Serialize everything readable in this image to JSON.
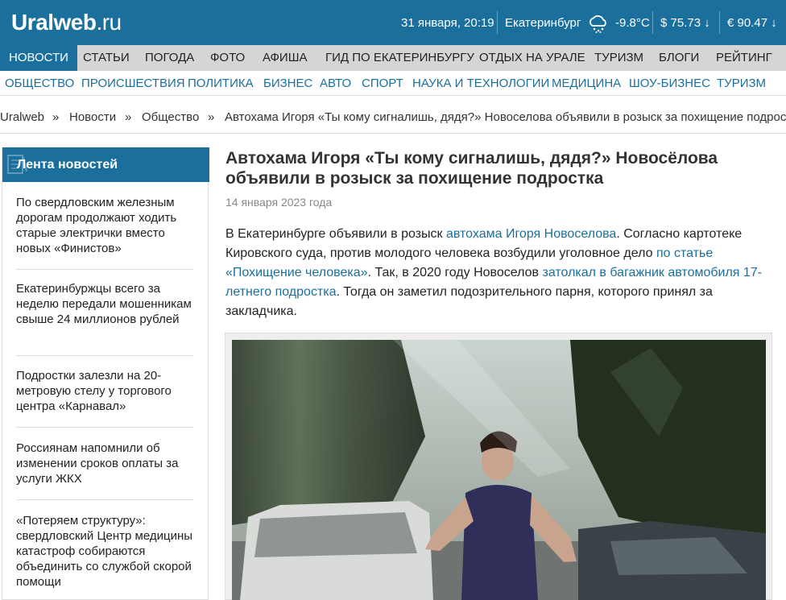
{
  "header": {
    "logo_main": "Uralweb",
    "logo_tld": ".ru",
    "datetime": "31 января, 20:19",
    "city": "Екатеринбург",
    "weather_icon": "snow-cloud-icon",
    "temperature": "-9.8°C",
    "usd": "$ 75.73 ↓",
    "eur": "€ 90.47 ↓"
  },
  "mainnav": [
    "НОВОСТИ",
    "СТАТЬИ",
    "ПОГОДА",
    "ФОТО",
    "АФИША",
    "ГИД ПО ЕКАТЕРИНБУРГУ",
    "ОТДЫХ НА УРАЛЕ",
    "ТУРИЗМ",
    "БЛОГИ",
    "РЕЙТИНГ"
  ],
  "subnav": [
    "ОБЩЕСТВО",
    "ПРОИСШЕСТВИЯ",
    "ПОЛИТИКА",
    "БИЗНЕС",
    "АВТО",
    "СПОРТ",
    "НАУКА И ТЕХНОЛОГИИ",
    "МЕДИЦИНА",
    "ШОУ-БИЗНЕС",
    "ТУРИЗМ"
  ],
  "breadcrumb": {
    "home": "Uralweb",
    "sep": "»",
    "news": "Новости",
    "section": "Общество",
    "current": "Автохама Игоря «Ты кому сигналишь, дядя?» Новоселова объявили в розыск за похищение подростка"
  },
  "sidebar": {
    "title": "Лента новостей",
    "items": [
      "По свердловским железным дорогам продолжают ходить старые электрички вместо новых «Финистов»",
      "Екатеринбуржцы всего за неделю передали мошенникам свыше 24 миллионов рублей",
      "Подростки залезли на 20-метровую стелу у торгового центра «Карнавал»",
      "Россиянам напомнили об изменении сроков оплаты за услуги ЖКХ",
      "«Потеряем структуру»: свердловский Центр медицины катастроф собираются объединить со службой скорой помощи"
    ]
  },
  "article": {
    "title": "Автохама Игоря «Ты кому сигналишь, дядя?» Новосёлова объявили в розыск за похищение подростка",
    "date": "14 января 2023 года",
    "p1": "В Екатеринбурге объявили в розыск ",
    "link1": "автохама Игоря Новоселова",
    "p2": ". Согласно картотеке Кировского суда, против молодого человека возбудили уголовное дело ",
    "link2": "по статье «Похищение человека»",
    "p3": ". Так, в 2020 году Новоселов ",
    "link3": "затолкал в багажник автомобиля 17-летнего подростка",
    "p4": ". Тогда он заметил подозрительного парня, которого принял за закладчика."
  },
  "colors": {
    "brand": "#1a6f9c",
    "nav_bg": "#d5d5d5"
  }
}
